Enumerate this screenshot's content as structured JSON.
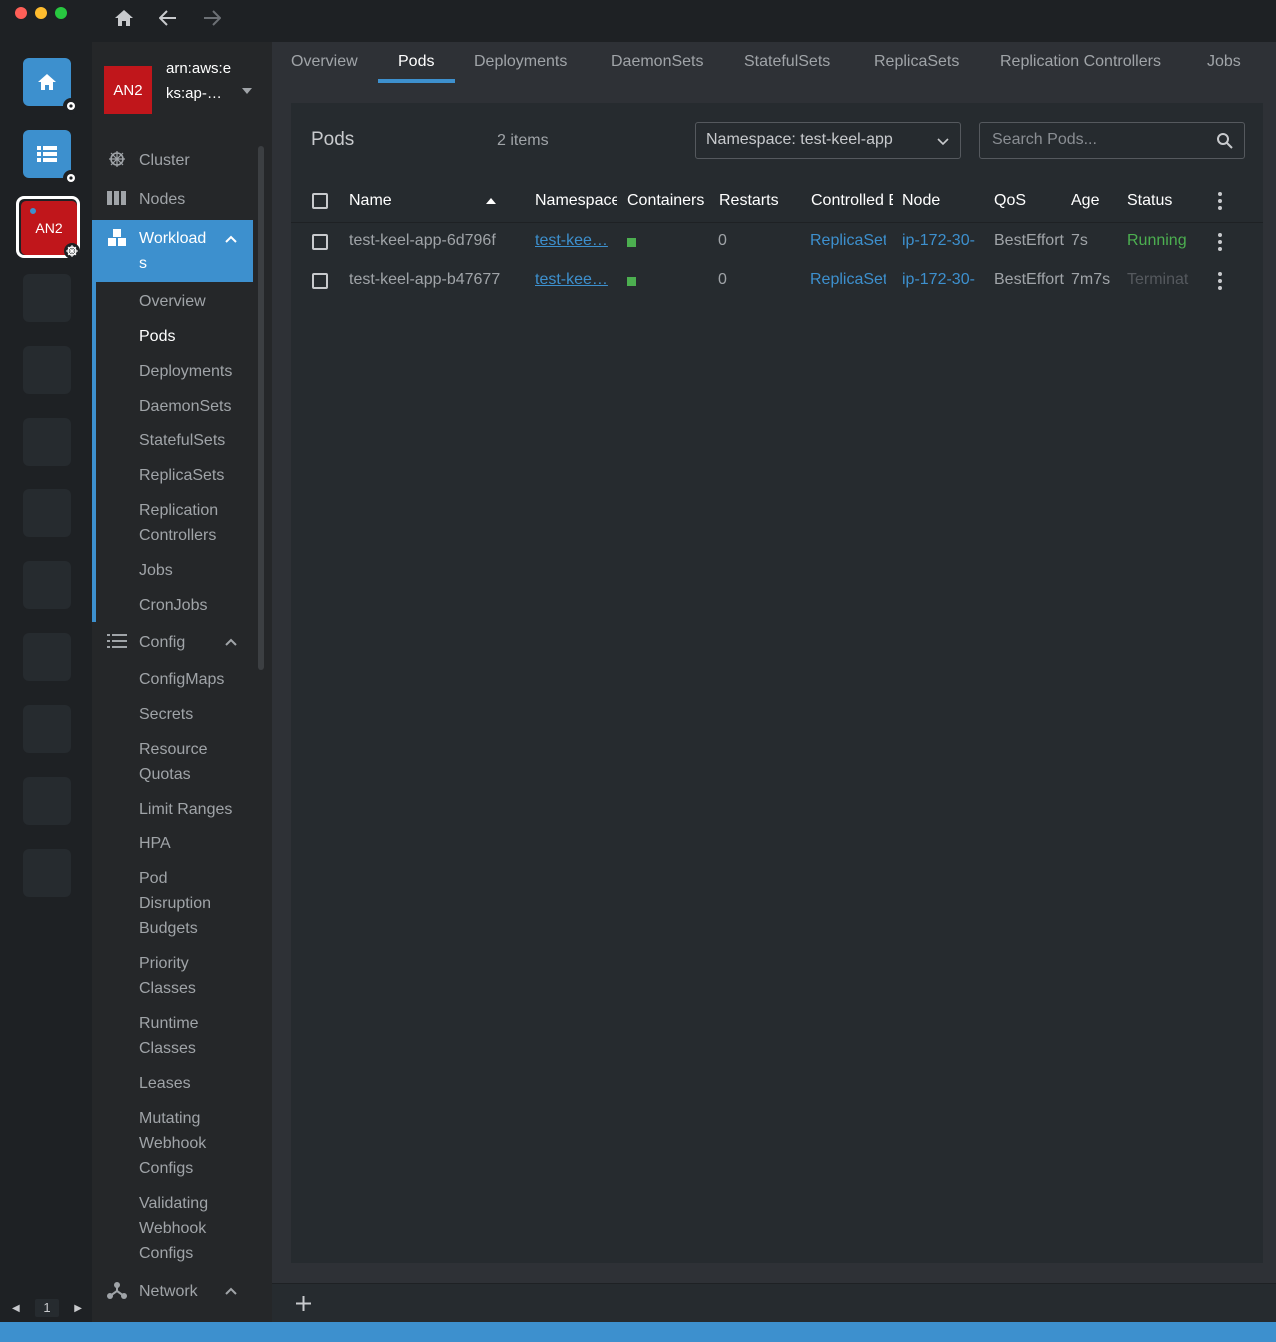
{
  "window": {
    "nav": [
      "home-icon",
      "back-arrow-icon",
      "forward-arrow-icon"
    ]
  },
  "hotbar": {
    "active_cluster_label": "AN2",
    "page": "1"
  },
  "cluster": {
    "avatar": "AN2",
    "name": "arn:aws:eks:ap-…"
  },
  "sidebar": {
    "cluster": "Cluster",
    "nodes": "Nodes",
    "workloads": "Workloads",
    "workloads_sub": [
      "Overview",
      "Pods",
      "Deployments",
      "DaemonSets",
      "StatefulSets",
      "ReplicaSets",
      "Replication Controllers",
      "Jobs",
      "CronJobs"
    ],
    "config": "Config",
    "config_sub": [
      "ConfigMaps",
      "Secrets",
      "Resource Quotas",
      "Limit Ranges",
      "HPA",
      "Pod Disruption Budgets",
      "Priority Classes",
      "Runtime Classes",
      "Leases",
      "Mutating Webhook Configs",
      "Validating Webhook Configs"
    ],
    "network": "Network"
  },
  "tabs": [
    "Overview",
    "Pods",
    "Deployments",
    "DaemonSets",
    "StatefulSets",
    "ReplicaSets",
    "Replication Controllers",
    "Jobs"
  ],
  "panel": {
    "title": "Pods",
    "count": "2 items",
    "namespace_select": "Namespace: test-keel-app",
    "search_placeholder": "Search Pods..."
  },
  "table": {
    "columns": [
      "Name",
      "Namespace",
      "Containers",
      "Restarts",
      "Controlled By",
      "Node",
      "QoS",
      "Age",
      "Status"
    ],
    "rows": [
      {
        "name": "test-keel-app-6d796f",
        "namespace": "test-kee…",
        "restarts": "0",
        "controlled": "ReplicaSet",
        "node": "ip-172-30-",
        "qos": "BestEffort",
        "age": "7s",
        "status": "Running",
        "status_color": "#4caf50"
      },
      {
        "name": "test-keel-app-b47677",
        "namespace": "test-kee…",
        "restarts": "0",
        "controlled": "ReplicaSet",
        "node": "ip-172-30-",
        "qos": "BestEffort",
        "age": "7m7s",
        "status": "Terminating",
        "status_color": "#55595e"
      }
    ]
  },
  "colors": {
    "accent": "#3d90ce",
    "cluster": "#c0161b",
    "running": "#4caf50"
  }
}
